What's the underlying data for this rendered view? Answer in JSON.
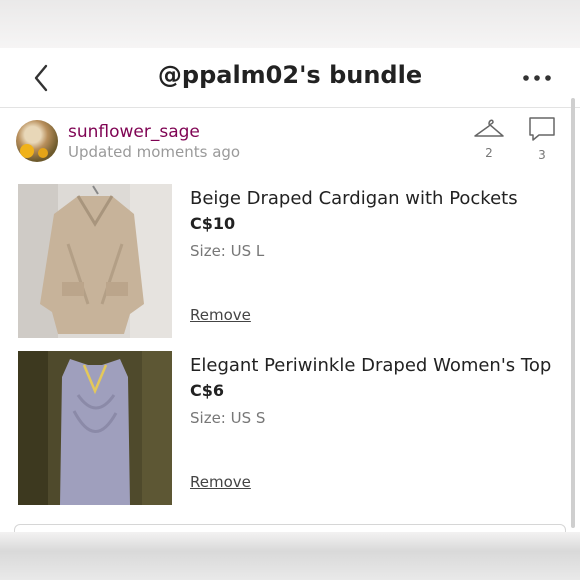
{
  "header": {
    "title": "@ppalm02's bundle"
  },
  "seller": {
    "username": "sunflower_sage",
    "updated_text": "Updated moments ago",
    "likes_count": "2",
    "comments_count": "3"
  },
  "items": [
    {
      "title": "Beige Draped Cardigan with Pockets",
      "price": "C$10",
      "size": "Size: US L",
      "remove_label": "Remove"
    },
    {
      "title": "Elegant Periwinkle Draped Women's Top",
      "price": "C$6",
      "size": "Size: US S",
      "remove_label": "Remove"
    }
  ],
  "colors": {
    "username": "#7f0353",
    "background": "#ffffff"
  },
  "icons": {
    "back": "chevron-left-icon",
    "more": "more-dots-icon",
    "likes": "hanger-icon",
    "comments": "comment-icon"
  }
}
